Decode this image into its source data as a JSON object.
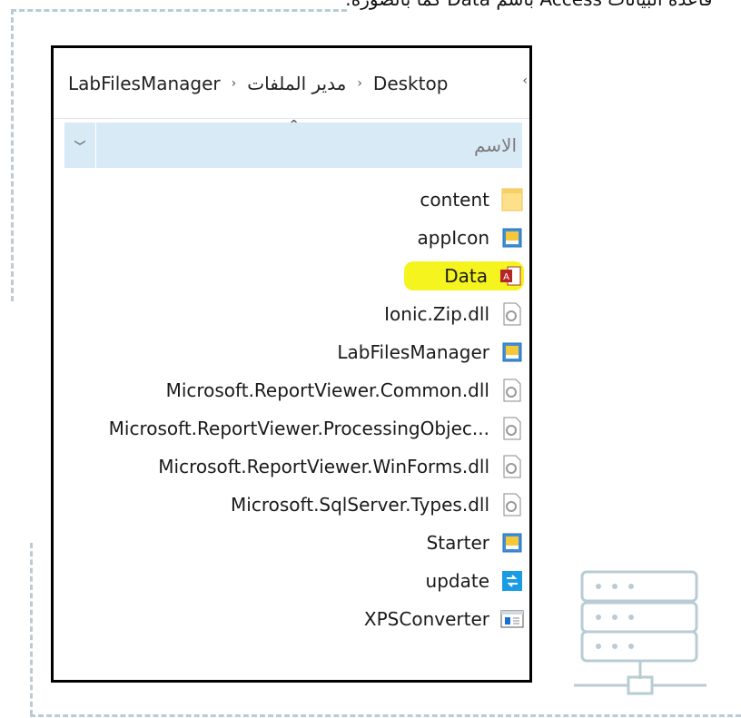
{
  "caption": "قاعدة البيانات Access باسم Data كما بالصورة:",
  "breadcrumb": {
    "items": [
      "Desktop",
      "مدير الملفات",
      "LabFilesManager"
    ]
  },
  "column": {
    "name_label": "الاسم"
  },
  "files": [
    {
      "name": "content",
      "icon": "folder-icon"
    },
    {
      "name": "appIcon",
      "icon": "app-image-icon"
    },
    {
      "name": "Data",
      "icon": "access-database-icon",
      "highlighted": true
    },
    {
      "name": "Ionic.Zip.dll",
      "icon": "dll-file-icon"
    },
    {
      "name": "LabFilesManager",
      "icon": "app-image-icon"
    },
    {
      "name": "Microsoft.ReportViewer.Common.dll",
      "icon": "dll-file-icon"
    },
    {
      "name": "Microsoft.ReportViewer.ProcessingObjec...",
      "icon": "dll-file-icon"
    },
    {
      "name": "Microsoft.ReportViewer.WinForms.dll",
      "icon": "dll-file-icon"
    },
    {
      "name": "Microsoft.SqlServer.Types.dll",
      "icon": "dll-file-icon"
    },
    {
      "name": "Starter",
      "icon": "app-image-icon"
    },
    {
      "name": "update",
      "icon": "update-icon"
    },
    {
      "name": "XPSConverter",
      "icon": "window-app-icon"
    }
  ],
  "colors": {
    "highlight": "#f6f41f",
    "header_bg": "#d9eaf7",
    "dashed_frame": "#b9ccd4"
  }
}
